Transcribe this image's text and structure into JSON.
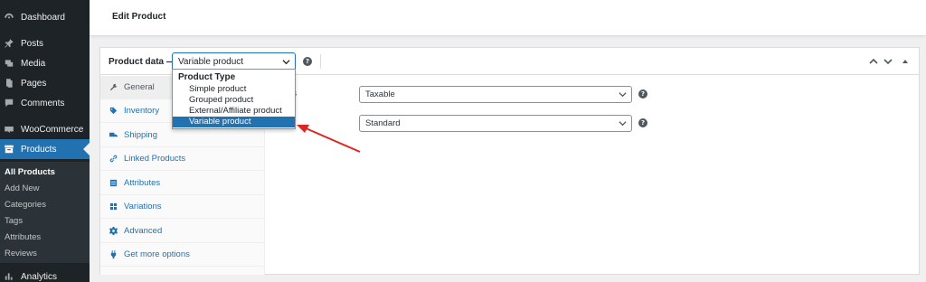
{
  "sidebar": {
    "items": [
      {
        "label": "Dashboard",
        "icon": "dashboard-icon"
      },
      {
        "label": "Posts",
        "icon": "pin-icon"
      },
      {
        "label": "Media",
        "icon": "media-icon"
      },
      {
        "label": "Pages",
        "icon": "pages-icon"
      },
      {
        "label": "Comments",
        "icon": "comment-icon"
      },
      {
        "label": "WooCommerce",
        "icon": "woo-icon"
      },
      {
        "label": "Products",
        "icon": "archive-icon"
      },
      {
        "label": "Analytics",
        "icon": "chart-icon"
      }
    ],
    "submenu": [
      "All Products",
      "Add New",
      "Categories",
      "Tags",
      "Attributes",
      "Reviews"
    ]
  },
  "header": {
    "title": "Edit Product"
  },
  "product_data": {
    "label": "Product data —",
    "selected_type": "Variable product",
    "dropdown": {
      "group_label": "Product Type",
      "options": [
        "Simple product",
        "Grouped product",
        "External/Affiliate product",
        "Variable product"
      ],
      "selected_index": 3
    },
    "tabs": [
      {
        "label": "General",
        "icon": "wrench-icon"
      },
      {
        "label": "Inventory",
        "icon": "tag-icon"
      },
      {
        "label": "Shipping",
        "icon": "truck-icon"
      },
      {
        "label": "Linked Products",
        "icon": "link-icon"
      },
      {
        "label": "Attributes",
        "icon": "list-icon"
      },
      {
        "label": "Variations",
        "icon": "grid-icon"
      },
      {
        "label": "Advanced",
        "icon": "gear-icon"
      },
      {
        "label": "Get more options",
        "icon": "plugin-icon"
      }
    ],
    "fields": [
      {
        "label": "us",
        "value": "Taxable"
      },
      {
        "label": "s",
        "value": "Standard"
      }
    ]
  },
  "colors": {
    "accent": "#2271b1",
    "sidebar": "#1d2327",
    "annotation": "#e02424"
  }
}
